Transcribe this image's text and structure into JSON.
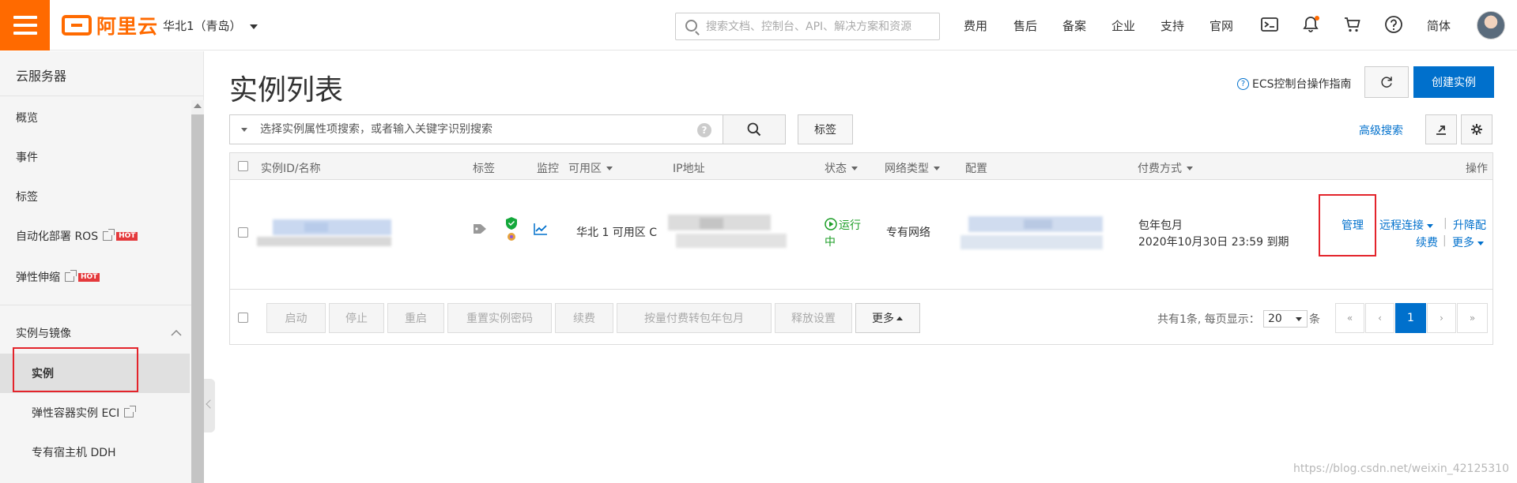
{
  "header": {
    "logo_text": "阿里云",
    "region": "华北1（青岛）",
    "search_placeholder": "搜索文档、控制台、API、解决方案和资源",
    "nav": [
      "费用",
      "售后",
      "备案",
      "企业",
      "支持",
      "官网"
    ],
    "language": "简体",
    "accent_color": "#ff6a00"
  },
  "sidebar": {
    "title": "云服务器",
    "items": [
      {
        "label": "概览"
      },
      {
        "label": "事件"
      },
      {
        "label": "标签"
      },
      {
        "label": "自动化部署 ROS",
        "badge": "HOT"
      },
      {
        "label": "弹性伸缩",
        "badge": "HOT"
      }
    ],
    "group": {
      "label": "实例与镜像",
      "items": [
        {
          "label": "实例"
        },
        {
          "label": "弹性容器实例 ECI"
        },
        {
          "label": "专有宿主机 DDH"
        }
      ]
    }
  },
  "main": {
    "title": "实例列表",
    "guide_link": "ECS控制台操作指南",
    "create_button": "创建实例",
    "filter_placeholder": "选择实例属性项搜索，或者输入关键字识别搜索",
    "tag_button": "标签",
    "advanced_search": "高级搜索",
    "primary_color": "#0070cc",
    "columns": {
      "id": "实例ID/名称",
      "tag": "标签",
      "monitor": "监控",
      "zone": "可用区",
      "ip": "IP地址",
      "status": "状态",
      "network": "网络类型",
      "config": "配置",
      "billing": "付费方式",
      "ops": "操作"
    },
    "row": {
      "zone": "华北 1 可用区 C",
      "status_1": "运行",
      "status_2": "中",
      "network": "专有网络",
      "billing_type": "包年包月",
      "expiry": "2020年10月30日 23:59 到期",
      "op_manage": "管理",
      "op_remote": "远程连接",
      "op_upgrade": "升降配",
      "op_renew": "续费",
      "op_more": "更多"
    },
    "batch_actions": [
      "启动",
      "停止",
      "重启",
      "重置实例密码",
      "续费",
      "按量付费转包年包月",
      "释放设置"
    ],
    "batch_more": "更多",
    "pagination": {
      "summary": "共有1条, 每页显示：",
      "page_size": "20",
      "unit": "条",
      "first": "«",
      "prev": "‹",
      "current": "1",
      "next": "›",
      "last": "»"
    }
  },
  "watermark": "https://blog.csdn.net/weixin_42125310"
}
